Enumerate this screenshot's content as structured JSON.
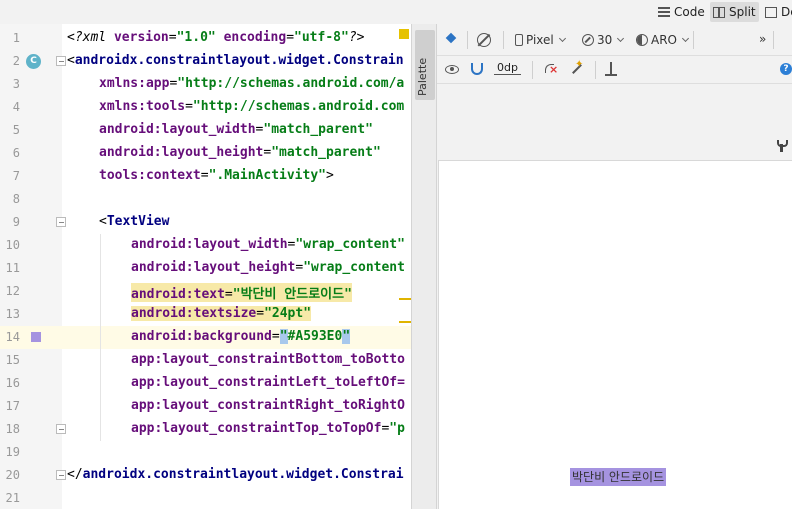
{
  "view_modes": {
    "code_label": "Code",
    "split_label": "Split",
    "design_label": "De"
  },
  "editor": {
    "lines": [
      {
        "number": "1"
      },
      {
        "number": "2",
        "badge": "C"
      },
      {
        "number": "3"
      },
      {
        "number": "4"
      },
      {
        "number": "5"
      },
      {
        "number": "6"
      },
      {
        "number": "7"
      },
      {
        "number": "8"
      },
      {
        "number": "9"
      },
      {
        "number": "10"
      },
      {
        "number": "11"
      },
      {
        "number": "12"
      },
      {
        "number": "13"
      },
      {
        "number": "14"
      },
      {
        "number": "15"
      },
      {
        "number": "16"
      },
      {
        "number": "17"
      },
      {
        "number": "18"
      },
      {
        "number": "19"
      },
      {
        "number": "20"
      },
      {
        "number": "21"
      }
    ],
    "code": {
      "l1_open": "<?",
      "l1_pi": "xml ",
      "l1_attr1": "version",
      "l1_eq1": "=",
      "l1_val1": "\"1.0\"",
      "l1_sp": " ",
      "l1_attr2": "encoding",
      "l1_eq2": "=",
      "l1_val2": "\"utf-8\"",
      "l1_close": "?>",
      "l2_lt": "<",
      "l2_tag": "androidx.constraintlayout.widget.Constrain",
      "l3_attr": "xmlns:app",
      "l3_eq": "=",
      "l3_val": "\"http://schemas.android.com/a",
      "l4_attr": "xmlns:tools",
      "l4_eq": "=",
      "l4_val": "\"http://schemas.android.com",
      "l5_attr": "android:layout_width",
      "l5_eq": "=",
      "l5_val": "\"match_parent\"",
      "l6_attr": "android:layout_height",
      "l6_eq": "=",
      "l6_val": "\"match_parent\"",
      "l7_attr": "tools:context",
      "l7_eq": "=",
      "l7_val": "\".MainActivity\"",
      "l7_gt": ">",
      "l9_lt": "<",
      "l9_tag": "TextView",
      "l10_attr": "android:layout_width",
      "l10_eq": "=",
      "l10_val": "\"wrap_content\"",
      "l11_attr": "android:layout_height",
      "l11_eq": "=",
      "l11_val": "\"wrap_content",
      "l12_attr": "android:text",
      "l12_eq": "=",
      "l12_val": "\"박단비 안드로이드\"",
      "l13_attr": "android:textsize",
      "l13_eq": "=",
      "l13_val": "\"24pt\"",
      "l14_attr": "android:background",
      "l14_eq": "=",
      "l14_q1": "\"",
      "l14_val": "#A593E0",
      "l14_q2": "\"",
      "l15_attr": "app:layout_constraintBottom_toBotto",
      "l16_attr": "app:layout_constraintLeft_toLeftOf=",
      "l17_attr": "app:layout_constraintRight_toRightO",
      "l18_attr": "app:layout_constraintTop_toTopOf",
      "l18_eq": "=",
      "l18_val": "\"p",
      "l20_open": "</",
      "l20_tag": "androidx.constraintlayout.widget.Constrai"
    },
    "background_swatch_color": "#A593E0"
  },
  "palette": {
    "label": "Palette"
  },
  "design_toolbar": {
    "device": "Pixel",
    "api_level": "30",
    "theme": "ARO",
    "overflow": "»",
    "default_margin": "0dp",
    "help": "?",
    "icons": [
      "layers-icon",
      "orientation-icon",
      "device-icon",
      "api-icon",
      "theme-icon",
      "eye-icon",
      "magnet-icon",
      "clear-constraints-icon",
      "infer-constraints-icon",
      "align-icon",
      "help-icon",
      "wrench-icon"
    ]
  },
  "preview": {
    "text": "박단비 안드로이드",
    "background": "#A593E0"
  }
}
